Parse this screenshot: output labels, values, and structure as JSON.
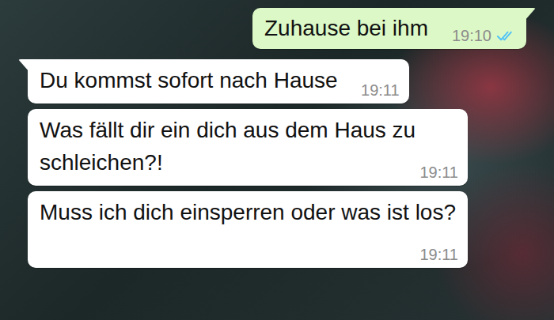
{
  "chat": {
    "messages": [
      {
        "direction": "outgoing",
        "text": "Zuhause bei ihm",
        "time": "19:10",
        "read": true
      },
      {
        "direction": "incoming",
        "text": "Du kommst sofort nach Hause",
        "time": "19:11"
      },
      {
        "direction": "incoming",
        "text": "Was fällt dir ein dich aus dem Haus zu schleichen?!",
        "time": "19:11"
      },
      {
        "direction": "incoming",
        "text": "Muss ich dich einsperren oder was ist los?",
        "time": "19:11"
      }
    ]
  }
}
